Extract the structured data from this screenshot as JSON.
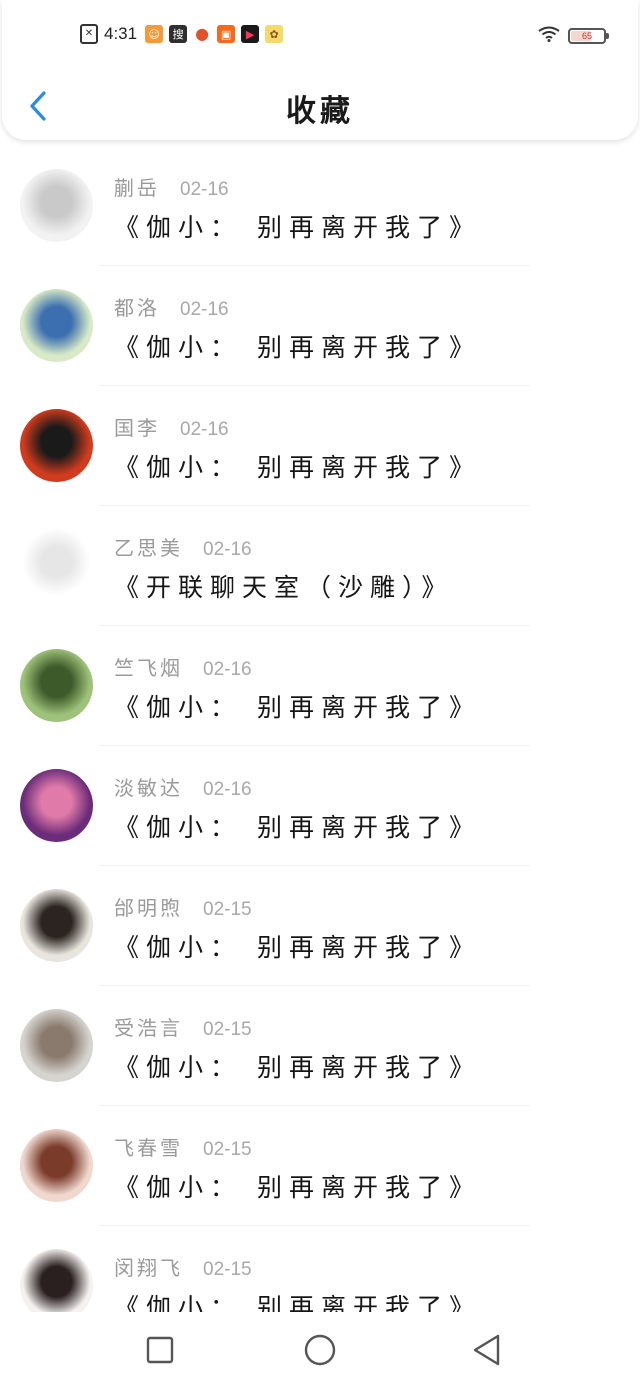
{
  "status_bar": {
    "time": "4:31",
    "sou_icon_label": "搜",
    "battery_level": 65,
    "battery_text": "65"
  },
  "header": {
    "title": "收藏"
  },
  "favorites": [
    {
      "name": "蒯岳",
      "date": "02-16",
      "message": "《伽小： 别再离开我了》",
      "avatar_colors": [
        "#f2f2f2",
        "#c9c9c9"
      ]
    },
    {
      "name": "都洛",
      "date": "02-16",
      "message": "《伽小： 别再离开我了》",
      "avatar_colors": [
        "#d7e9c6",
        "#3b6fb0"
      ]
    },
    {
      "name": "国李",
      "date": "02-16",
      "message": "《伽小： 别再离开我了》",
      "avatar_colors": [
        "#d23c1e",
        "#1a1a1a"
      ]
    },
    {
      "name": "乙思美",
      "date": "02-16",
      "message": "《开联聊天室（沙雕）》",
      "avatar_colors": [
        "#ffffff",
        "#e6e6e6"
      ]
    },
    {
      "name": "竺飞烟",
      "date": "02-16",
      "message": "《伽小： 别再离开我了》",
      "avatar_colors": [
        "#9ec27a",
        "#3d5a2a"
      ]
    },
    {
      "name": "淡敏达",
      "date": "02-16",
      "message": "《伽小： 别再离开我了》",
      "avatar_colors": [
        "#6b2c7a",
        "#e07aa8"
      ]
    },
    {
      "name": "邰明煦",
      "date": "02-15",
      "message": "《伽小： 别再离开我了》",
      "avatar_colors": [
        "#e8e4de",
        "#2b2420"
      ]
    },
    {
      "name": "受浩言",
      "date": "02-15",
      "message": "《伽小： 别再离开我了》",
      "avatar_colors": [
        "#d6d4cf",
        "#8a7a6e"
      ]
    },
    {
      "name": "飞春雪",
      "date": "02-15",
      "message": "《伽小： 别再离开我了》",
      "avatar_colors": [
        "#f0d8cf",
        "#7a3b2a"
      ]
    },
    {
      "name": "闵翔飞",
      "date": "02-15",
      "message": "《伽小： 别再离开我了》",
      "avatar_colors": [
        "#f4f1ef",
        "#2a2020"
      ]
    }
  ],
  "colors": {
    "accent": "#2a8be8",
    "name_gray": "#9a9a9a",
    "message_black": "#161616"
  }
}
